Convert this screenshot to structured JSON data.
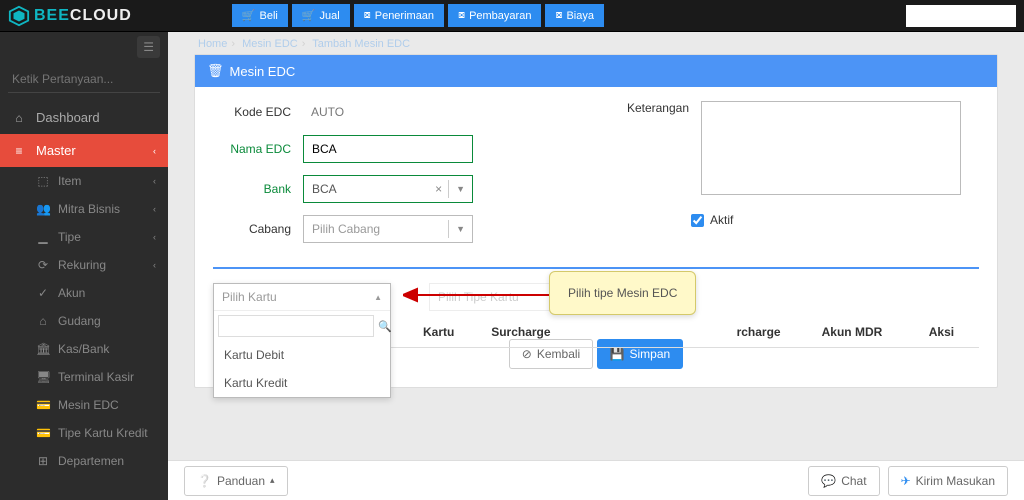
{
  "brand": {
    "part1": "BEE",
    "part2": "CLOUD"
  },
  "topbuttons": [
    {
      "icon": "cart",
      "label": "Beli"
    },
    {
      "icon": "cart",
      "label": "Jual"
    },
    {
      "icon": "cash",
      "label": "Penerimaan"
    },
    {
      "icon": "cash",
      "label": "Pembayaran"
    },
    {
      "icon": "cash",
      "label": "Biaya"
    }
  ],
  "sidebar": {
    "search_placeholder": "Ketik Pertanyaan...",
    "items": [
      {
        "icon": "dash",
        "label": "Dashboard",
        "active": false
      },
      {
        "icon": "db",
        "label": "Master",
        "active": true,
        "expandable": true
      }
    ],
    "subitems": [
      {
        "icon": "cube",
        "label": "Item",
        "expandable": true
      },
      {
        "icon": "people",
        "label": "Mitra Bisnis",
        "expandable": true
      },
      {
        "icon": "bars",
        "label": "Tipe",
        "expandable": true
      },
      {
        "icon": "cycle",
        "label": "Rekuring",
        "expandable": true
      },
      {
        "icon": "check",
        "label": "Akun"
      },
      {
        "icon": "home",
        "label": "Gudang"
      },
      {
        "icon": "bank",
        "label": "Kas/Bank"
      },
      {
        "icon": "terminal",
        "label": "Terminal Kasir"
      },
      {
        "icon": "card",
        "label": "Mesin EDC"
      },
      {
        "icon": "card",
        "label": "Tipe Kartu Kredit"
      },
      {
        "icon": "sitemap",
        "label": "Departemen"
      }
    ]
  },
  "breadcrumb": [
    "Home",
    "Mesin EDC",
    "Tambah Mesin EDC"
  ],
  "panel": {
    "title": "Mesin EDC",
    "labels": {
      "kode": "Kode EDC",
      "nama": "Nama EDC",
      "bank": "Bank",
      "cabang": "Cabang",
      "keterangan": "Keterangan",
      "aktif": "Aktif"
    },
    "values": {
      "kode": "AUTO",
      "nama": "BCA",
      "bank": "BCA",
      "cabang_placeholder": "Pilih Cabang",
      "keterangan": "",
      "aktif": true
    },
    "dropdown": {
      "placeholder": "Pilih Kartu",
      "ghost_placeholder": "Pilih Tipe Kartu",
      "options": [
        "Kartu Debit",
        "Kartu Kredit"
      ]
    },
    "table_headers": [
      "Kartu",
      "Surcharge",
      "rcharge",
      "Akun MDR",
      "Aksi"
    ],
    "callout": "Pilih tipe Mesin EDC",
    "actions": {
      "back": "Kembali",
      "save": "Simpan"
    }
  },
  "footer": {
    "panduan": "Panduan",
    "chat": "Chat",
    "kirim": "Kirim Masukan"
  }
}
